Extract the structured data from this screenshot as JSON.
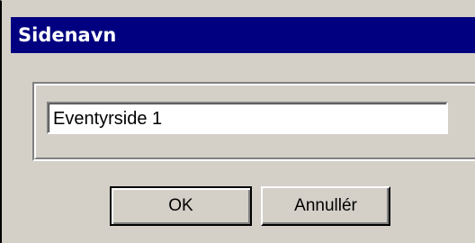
{
  "dialog": {
    "title": "Sidenavn",
    "page_name_value": "Eventyrside 1",
    "ok_label": "OK",
    "cancel_label": "Annullér"
  },
  "colors": {
    "titlebar": "#000080",
    "face": "#d4d0c8"
  }
}
